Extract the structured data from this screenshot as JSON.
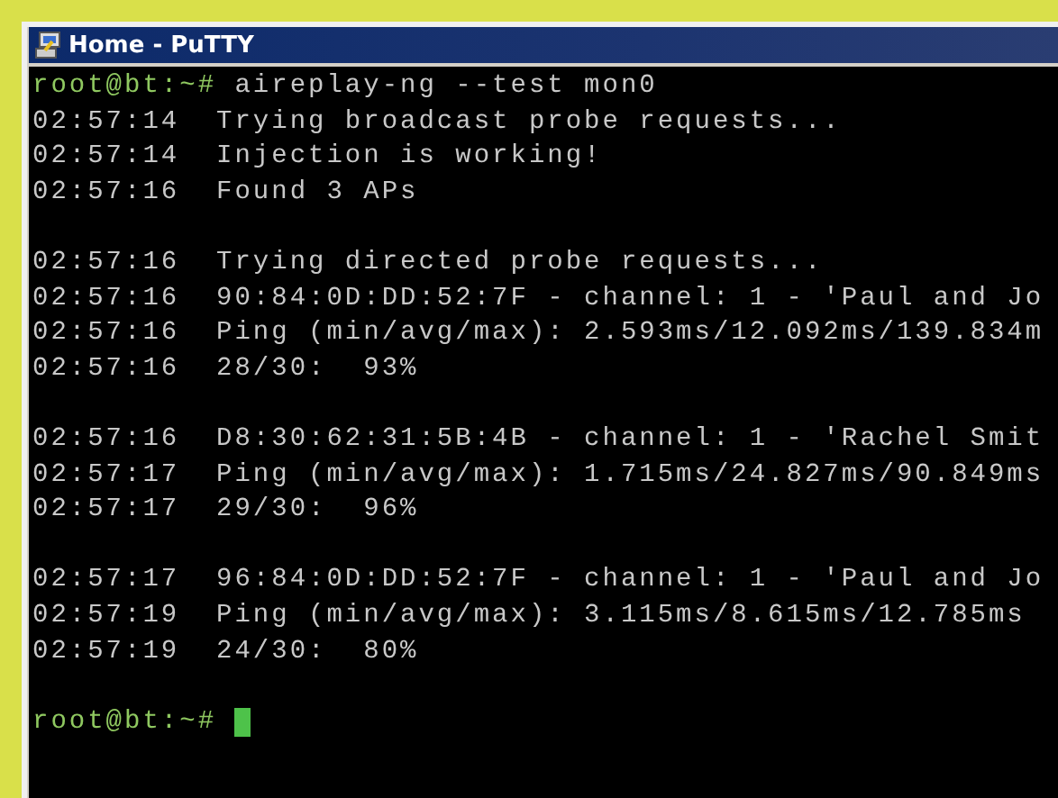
{
  "window": {
    "title": "Home - PuTTY"
  },
  "terminal": {
    "lines": [
      {
        "kind": "prompt",
        "prompt": "root@bt:~#",
        "command": "aireplay-ng --test mon0",
        "cursor": false
      },
      {
        "kind": "output",
        "text": "02:57:14  Trying broadcast probe requests..."
      },
      {
        "kind": "output",
        "text": "02:57:14  Injection is working!"
      },
      {
        "kind": "output",
        "text": "02:57:16  Found 3 APs"
      },
      {
        "kind": "blank"
      },
      {
        "kind": "output",
        "text": "02:57:16  Trying directed probe requests..."
      },
      {
        "kind": "output",
        "text": "02:57:16  90:84:0D:DD:52:7F - channel: 1 - 'Paul and Jo"
      },
      {
        "kind": "output",
        "text": "02:57:16  Ping (min/avg/max): 2.593ms/12.092ms/139.834m"
      },
      {
        "kind": "output",
        "text": "02:57:16  28/30:  93%"
      },
      {
        "kind": "blank"
      },
      {
        "kind": "output",
        "text": "02:57:16  D8:30:62:31:5B:4B - channel: 1 - 'Rachel Smit"
      },
      {
        "kind": "output",
        "text": "02:57:17  Ping (min/avg/max): 1.715ms/24.827ms/90.849ms"
      },
      {
        "kind": "output",
        "text": "02:57:17  29/30:  96%"
      },
      {
        "kind": "blank"
      },
      {
        "kind": "output",
        "text": "02:57:17  96:84:0D:DD:52:7F - channel: 1 - 'Paul and Jo"
      },
      {
        "kind": "output",
        "text": "02:57:19  Ping (min/avg/max): 3.115ms/8.615ms/12.785ms"
      },
      {
        "kind": "output",
        "text": "02:57:19  24/30:  80%"
      },
      {
        "kind": "blank"
      },
      {
        "kind": "prompt",
        "prompt": "root@bt:~#",
        "cursor": true
      }
    ]
  }
}
